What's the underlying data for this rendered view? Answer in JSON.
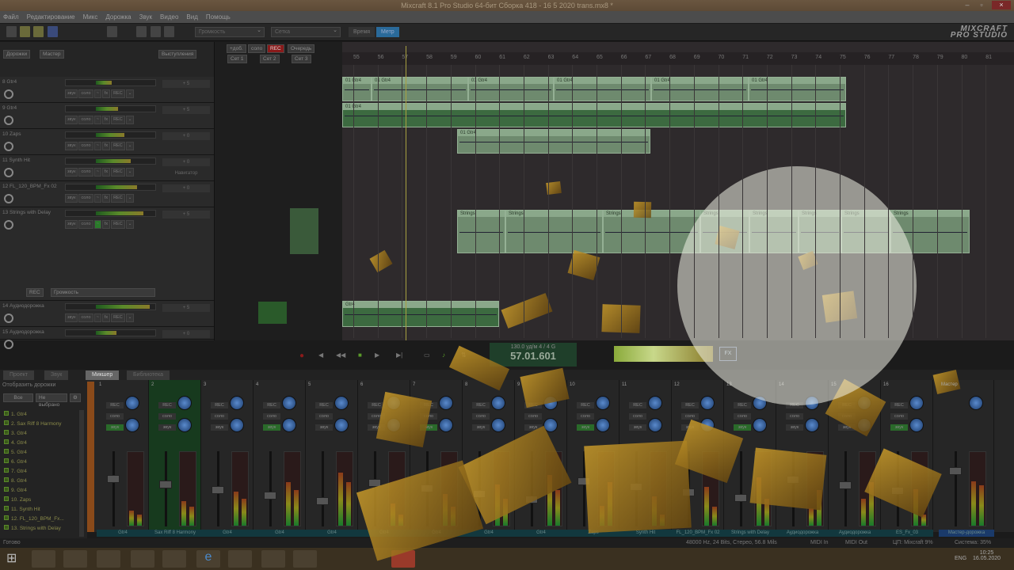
{
  "window": {
    "title": "Mixcraft 8.1 Pro Studio 64-бит Сборка 418 - 16 5 2020 trans.mx8 *",
    "min": "–",
    "max": "▫",
    "close": "×"
  },
  "menu": [
    "Файл",
    "Редактирование",
    "Микс",
    "Дорожка",
    "Звук",
    "Видео",
    "Вид",
    "Помощь"
  ],
  "toolbar": {
    "param_select": "Громкость",
    "grid_select": "Сетка",
    "time_btn": "Время",
    "bars_btn": "Метр",
    "logo_line1": "MIXCRAFT",
    "logo_line2": "PRO STUDIO"
  },
  "trackpanel": {
    "tracks_btn": "Дорожки",
    "master_btn": "Мастер",
    "perf_btn": "Выступления",
    "automation_rec": "REC",
    "automation_param": "Громкость"
  },
  "perf": {
    "add": "+доб.",
    "solo": "соло",
    "rec": "REC",
    "queue": "Очередь",
    "sets": [
      "Сет 1",
      "Сет 2",
      "Сет 3"
    ]
  },
  "tracks": [
    {
      "name": "8 Gtr4",
      "pan": "+ 5",
      "h": 33
    },
    {
      "name": "9 Gtr4",
      "pan": "+ 5",
      "h": 33
    },
    {
      "name": "10 Zaps",
      "pan": "+ 0",
      "h": 33
    },
    {
      "name": "11 Synth Hit",
      "pan": "+ 0",
      "note": "Навигатор",
      "h": 33
    },
    {
      "name": "12 FL_120_BPM_Fx 02",
      "pan": "+ 0",
      "h": 33
    },
    {
      "name": "13 Strings with Delay",
      "pan": "+ 5",
      "h": 118
    },
    {
      "name": "14 Аудиодорожка",
      "pan": "+ 5",
      "h": 33
    },
    {
      "name": "15 Аудиодорожка",
      "pan": "+ 0",
      "h": 16
    }
  ],
  "track_buttons": [
    "звук",
    "соло",
    "~",
    "fx",
    "REC",
    "⌄"
  ],
  "ruler": [
    55,
    56,
    57,
    58,
    59,
    60,
    61,
    62,
    63,
    64,
    65,
    66,
    67,
    68,
    69,
    70,
    71,
    72,
    73,
    74,
    75,
    76,
    77,
    78,
    79,
    80,
    81
  ],
  "clips": {
    "gtr": "01 Gtr4",
    "strings": "Strings",
    "audio": "Gtr4"
  },
  "transport": {
    "tempo": "130.0 уд/м",
    "meter": "4 / 4",
    "key": "G",
    "position": "57.01.601",
    "fx": "FX"
  },
  "tabs": [
    "Проект",
    "Звук",
    "Микшер",
    "Библиотека"
  ],
  "mixlist": {
    "title": "Отобразить дорожки",
    "all": "Все",
    "none": "Не выбрано",
    "items": [
      "1. Gtr4",
      "2. Sax Riff 8 Harmony",
      "3. Gtr4",
      "4. Gtr4",
      "5. Gtr4",
      "6. Gtr4",
      "7. Gtr4",
      "8. Gtr4",
      "9. Gtr4",
      "10. Zaps",
      "11. Synth Hit",
      "12. FL_120_BPM_Fx...",
      "13. Strings with Delay"
    ]
  },
  "mixer": {
    "channels": [
      "Gtr4",
      "Sax Riff 8 Harmony",
      "Gtr4",
      "Gtr4",
      "Gtr4",
      "Gtr4",
      "Gtr4",
      "Gtr4",
      "Gtr4",
      "Zaps",
      "Synth Hit",
      "FL_120_BPM_Fx 02",
      "Strings with Delay",
      "Аудиодорожка",
      "Аудиодорожка",
      "ES_Fx_03"
    ],
    "master": "Мастер-дорожка",
    "master_label": "Мастер",
    "rec": "REC",
    "solo": "соло",
    "mute": "звук"
  },
  "status": {
    "ready": "Готово",
    "format": "48000 Hz, 24 Bits, Стерео, 56.8 Mils",
    "midi_in": "MIDI In",
    "midi_out": "MIDI Out",
    "cpu": "ЦП: Mixcraft 9%",
    "system": "Система: 35%"
  },
  "taskbar": {
    "lang": "ENG",
    "time": "10:25",
    "date": "16.05.2020"
  }
}
